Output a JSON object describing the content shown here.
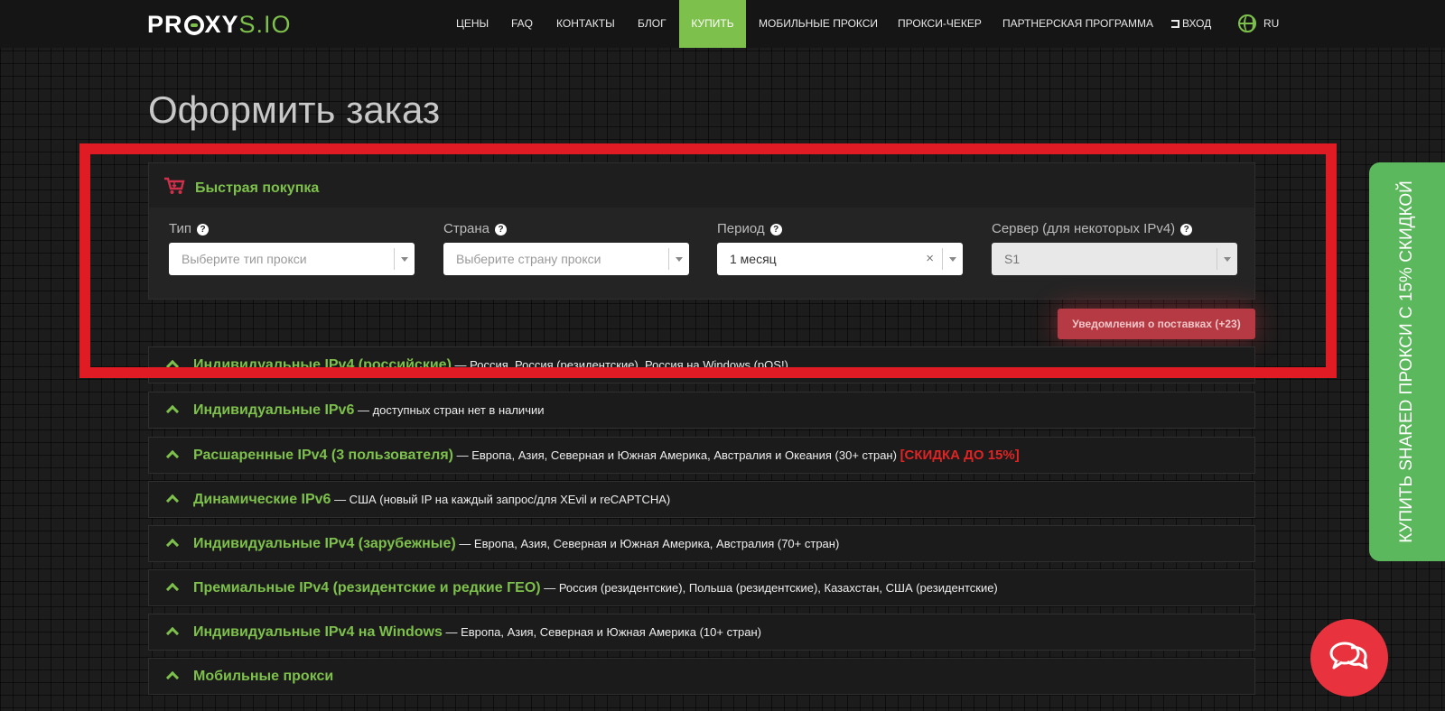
{
  "header": {
    "logo": {
      "part1": "PR",
      "part2": "XY",
      "part3": "S.IO"
    },
    "nav": [
      {
        "label": "ЦЕНЫ"
      },
      {
        "label": "FAQ"
      },
      {
        "label": "КОНТАКТЫ"
      },
      {
        "label": "БЛОГ"
      },
      {
        "label": "КУПИТЬ",
        "active": true
      },
      {
        "label": "МОБИЛЬНЫЕ ПРОКСИ"
      },
      {
        "label": "ПРОКСИ-ЧЕКЕР"
      },
      {
        "label": "ПАРТНЕРСКАЯ ПРОГРАММА"
      }
    ],
    "login_label": "ВХОД",
    "language": "RU"
  },
  "page": {
    "title": "Оформить заказ"
  },
  "quick_buy": {
    "title": "Быстрая покупка",
    "fields": {
      "type": {
        "label": "Тип",
        "placeholder": "Выберите тип прокси"
      },
      "country": {
        "label": "Страна",
        "placeholder": "Выберите страну прокси"
      },
      "period": {
        "label": "Период",
        "value": "1 месяц"
      },
      "server": {
        "label": "Сервер (для некоторых IPv4)",
        "value": "S1"
      }
    },
    "help_glyph": "?",
    "clear_glyph": "×",
    "notify_button": "Уведомления о поставках (+23)"
  },
  "categories": [
    {
      "title": "Индивидуальные IPv4 (российские)",
      "desc": " — Россия, Россия (резидентские), Россия на Windows (pOS!)"
    },
    {
      "title": "Индивидуальные IPv6",
      "desc": " — доступных стран нет в наличии"
    },
    {
      "title": "Расшаренные IPv4 (3 пользователя)",
      "desc": " — Европа, Азия, Северная и Южная Америка, Австралия и Океания (30+ стран) ",
      "badge": "[СКИДКА ДО 15%]"
    },
    {
      "title": "Динамические IPv6",
      "desc": " — США (новый IP на каждый запрос/для XEvil и reCAPTCHA)"
    },
    {
      "title": "Индивидуальные IPv4 (зарубежные)",
      "desc": " — Европа, Азия, Северная и Южная Америка, Австралия (70+ стран)"
    },
    {
      "title": "Премиальные IPv4 (резидентские и редкие ГЕО)",
      "desc": " — Россия (резидентские), Польша (резидентские), Казахстан, США (резидентские)"
    },
    {
      "title": "Индивидуальные IPv4 на Windows",
      "desc": " — Европа, Азия, Северная и Южная Америка (10+ стран)"
    },
    {
      "title": "Мобильные прокси",
      "desc": ""
    }
  ],
  "side_tab": {
    "label": "КУПИТЬ SHARED ПРОКСИ С 15% СКИДКОЙ"
  },
  "colors": {
    "brand_green": "#7dc04b",
    "highlight_red": "#e11b24",
    "discount_red": "#e02424",
    "chat_red": "#e8323d"
  },
  "icons": [
    "cart-icon",
    "help-icon",
    "login-icon",
    "globe-icon",
    "chevron-up-icon",
    "chat-icon"
  ]
}
